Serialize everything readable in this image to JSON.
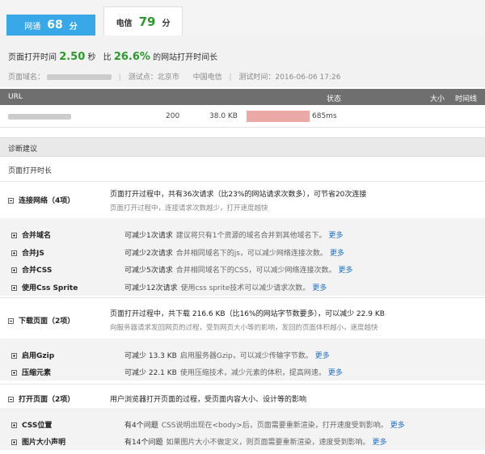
{
  "tabs": [
    {
      "label": "网通",
      "score": "68",
      "unit": "分"
    },
    {
      "label": "电信",
      "score": "79",
      "unit": "分"
    }
  ],
  "summary": {
    "prefix": "页面打开时间",
    "time": "2.50",
    "time_unit": "秒",
    "compare": "比",
    "percent": "26.6%",
    "suffix": "的网站打开时间长"
  },
  "meta": {
    "domain_label": "页面域名：",
    "location_label": "测试点：北京市",
    "isp": "中国电信",
    "time_label": "测试时间：2016-06-06 17:26"
  },
  "table": {
    "headers": {
      "url": "URL",
      "status": "状态",
      "size": "大小",
      "timeline": "时间线"
    },
    "row": {
      "status": "200",
      "size": "38.0 KB",
      "time": "685ms"
    }
  },
  "diag": {
    "title": "诊断建议",
    "subtitle": "页面打开时长",
    "more": "更多",
    "categories": [
      {
        "name": "连接网络（4项）",
        "desc": "页面打开过程中，共有36次请求（比23%的网站请求次数多），可节省20次连接",
        "sub": "页面打开过程中，连接请求次数越少，打开速度越快",
        "items": [
          {
            "name": "合并域名",
            "lead": "可减少1次请求",
            "rest": "建议将只有1个资源的域名合并到其他域名下。"
          },
          {
            "name": "合并JS",
            "lead": "可减少2次请求",
            "rest": "合并相同域名下的js，可以减少网络连接次数。"
          },
          {
            "name": "合并CSS",
            "lead": "可减少5次请求",
            "rest": "合并相同域名下的CSS，可以减少网络连接次数。"
          },
          {
            "name": "使用Css Sprite",
            "lead": "可减少12次请求",
            "rest": "使用css sprite技术可以减少请求次数。"
          }
        ]
      },
      {
        "name": "下载页面（2项）",
        "desc": "页面打开过程中，共下载 216.6 KB（比16%的网站字节数要多），可以减少 22.9 KB",
        "sub": "向服务器请求发回网页的过程，受到网页大小等的影响，发回的页面体积越小，速度越快",
        "items": [
          {
            "name": "启用Gzip",
            "lead": "可减少 13.3 KB",
            "rest": "启用服务器Gzip，可以减少传输字节数。"
          },
          {
            "name": "压缩元素",
            "lead": "可减少 22.1 KB",
            "rest": "使用压缩技术，减少元素的体积，提高网速。"
          }
        ]
      },
      {
        "name": "打开页面（2项）",
        "desc": "用户浏览器打开页面的过程，受页面内容大小、设计等的影响",
        "sub": "",
        "items": [
          {
            "name": "CSS位置",
            "lead": "有4个问题",
            "rest": "CSS说明出现在<body>后，页面需要重新渲染，打开速度受到影响。"
          },
          {
            "name": "图片大小声明",
            "lead": "有14个问题",
            "rest": "如果图片大小不做定义，则页面需要重新渲染，速度受到影响。"
          }
        ]
      }
    ]
  }
}
